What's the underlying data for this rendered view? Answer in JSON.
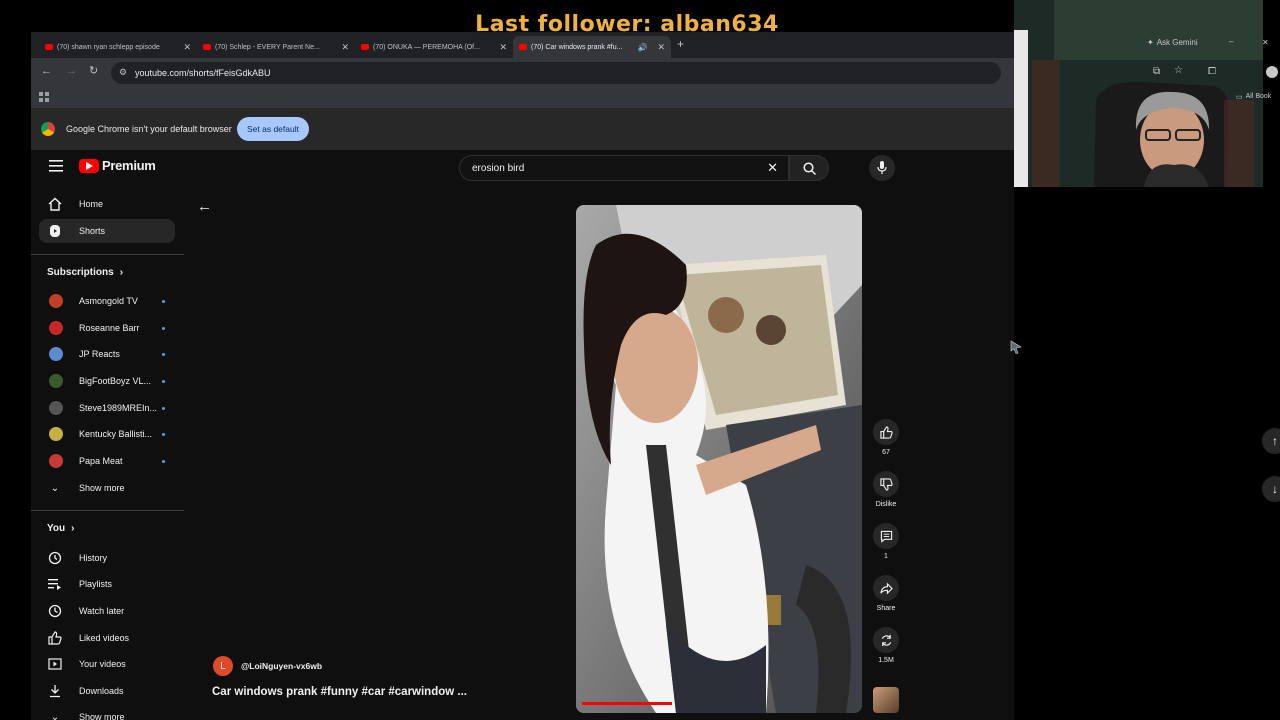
{
  "overlay": {
    "title": "Last follower: alban634"
  },
  "browser": {
    "tabs": [
      {
        "label": "(70) shawn ryan schlepp episode"
      },
      {
        "label": "(70) Schlep - EVERY Parent Ne..."
      },
      {
        "label": "(70) ONUKA — PEREMOHA (Of..."
      },
      {
        "label": "(70) Car windows prank #fu..."
      }
    ],
    "ask_gemini": "Ask Gemini",
    "url": "youtube.com/shorts/fFeisGdkABU",
    "all_bookmarks": "All Book",
    "infobar_text": "Google Chrome isn't your default browser",
    "set_default_label": "Set as default"
  },
  "youtube": {
    "logo_text": "Premium",
    "search_value": "erosion bird"
  },
  "sidebar": {
    "items": [
      {
        "label": "Home",
        "icon": "home-icon"
      },
      {
        "label": "Shorts",
        "icon": "shorts-icon"
      }
    ],
    "subscriptions_title": "Subscriptions",
    "subscriptions": [
      {
        "label": "Asmongold TV",
        "color": "#c0402a"
      },
      {
        "label": "Roseanne Barr",
        "color": "#c62828"
      },
      {
        "label": "JP Reacts",
        "color": "#5b8bd0"
      },
      {
        "label": "BigFootBoyz VL...",
        "color": "#3a5a2a"
      },
      {
        "label": "Steve1989MREIn...",
        "color": "#555555"
      },
      {
        "label": "Kentucky Ballisti...",
        "color": "#c8b040"
      },
      {
        "label": "Papa Meat",
        "color": "#c63a3a"
      }
    ],
    "show_more": "Show more",
    "you_title": "You",
    "you_items": [
      {
        "label": "History"
      },
      {
        "label": "Playlists"
      },
      {
        "label": "Watch later"
      },
      {
        "label": "Liked videos"
      },
      {
        "label": "Your videos"
      },
      {
        "label": "Downloads"
      },
      {
        "label": "Show more"
      }
    ]
  },
  "short": {
    "channel": "@LoiNguyen-vx6wb",
    "channel_initial": "L",
    "title": "Car windows prank #funny #car #carwindow ...",
    "likes": "67",
    "dislike_label": "Dislike",
    "comments": "1",
    "share_label": "Share",
    "remix_count": "1.5M"
  }
}
